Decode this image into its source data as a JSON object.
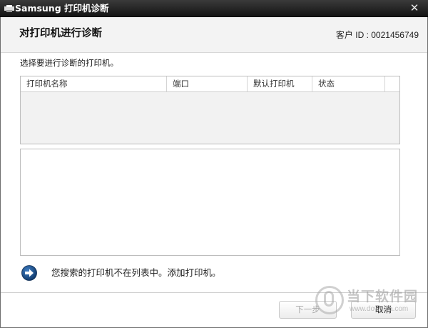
{
  "window": {
    "title": "Samsung 打印机诊断",
    "close_glyph": "✕"
  },
  "header": {
    "title": "对打印机进行诊断",
    "customer_id": "客户 ID : 0021456749"
  },
  "main": {
    "instruction": "选择要进行诊断的打印机。",
    "table": {
      "columns": [
        "打印机名称",
        "端口",
        "默认打印机",
        "状态"
      ],
      "rows": []
    },
    "add_printer_text": "您搜索的打印机不在列表中。添加打印机。"
  },
  "footer": {
    "next_label": "下一步",
    "cancel_label": "取消"
  },
  "watermark": {
    "name": "当下软件园",
    "url": "www.downxia.com"
  },
  "icons": {
    "title_icon": "printer-icon",
    "arrow_icon": "arrow-right-circle-icon"
  },
  "colors": {
    "titlebar": "#1e1e1e",
    "header_band": "#f3f3f3",
    "arrow_circle": "#1d4f8a"
  }
}
